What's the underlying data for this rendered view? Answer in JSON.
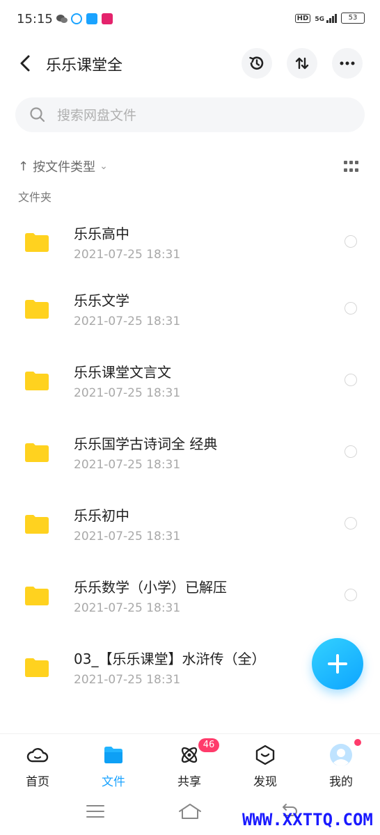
{
  "status": {
    "time": "15:15",
    "hd": "HD",
    "signal": "5G",
    "battery": "53"
  },
  "header": {
    "title": "乐乐课堂全"
  },
  "search": {
    "placeholder": "搜索网盘文件"
  },
  "sort": {
    "arrow": "↑",
    "label": "按文件类型",
    "caret": "⌄"
  },
  "section_label": "文件夹",
  "files": [
    {
      "name": "乐乐高中",
      "date": "2021-07-25  18:31"
    },
    {
      "name": "乐乐文学",
      "date": "2021-07-25  18:31"
    },
    {
      "name": "乐乐课堂文言文",
      "date": "2021-07-25  18:31"
    },
    {
      "name": "乐乐国学古诗词全 经典",
      "date": "2021-07-25  18:31"
    },
    {
      "name": "乐乐初中",
      "date": "2021-07-25  18:31"
    },
    {
      "name": "乐乐数学（小学）已解压",
      "date": "2021-07-25  18:31"
    },
    {
      "name": "03_【乐乐课堂】水浒传（全）",
      "date": "2021-07-25  18:31"
    }
  ],
  "nav": {
    "home": "首页",
    "files": "文件",
    "share": "共享",
    "share_badge": "46",
    "discover": "发现",
    "me": "我的"
  },
  "watermark": "WWW.XXTTQ.COM",
  "colors": {
    "accent": "#1aa3ff",
    "folder": "#ffd21f",
    "badge": "#ff3b6b"
  }
}
